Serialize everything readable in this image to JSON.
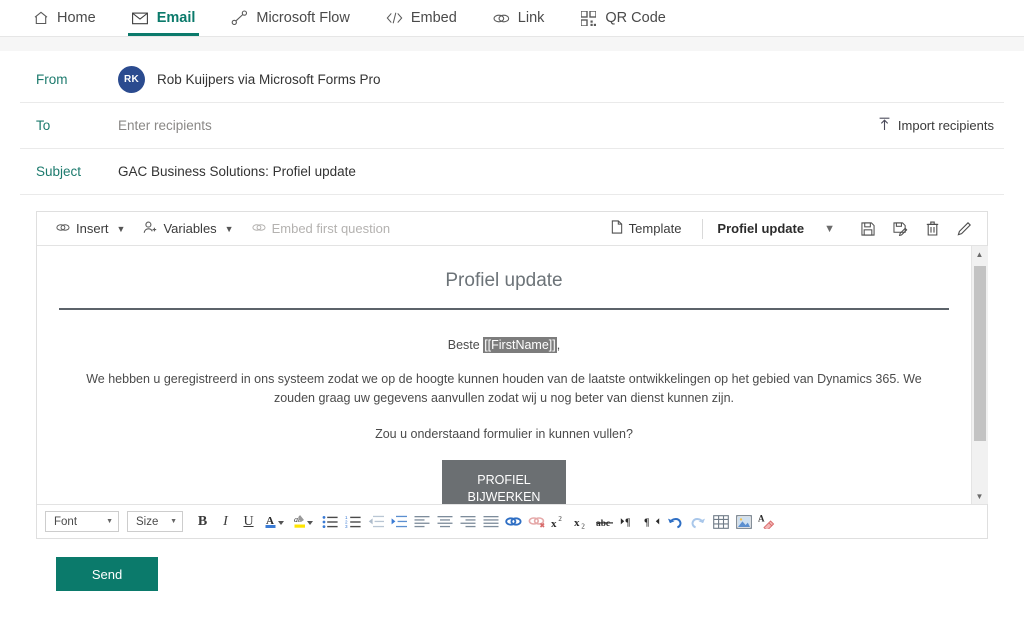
{
  "nav": {
    "tabs": [
      {
        "label": "Home",
        "icon": "home-icon",
        "active": false
      },
      {
        "label": "Email",
        "icon": "envelope-icon",
        "active": true
      },
      {
        "label": "Microsoft Flow",
        "icon": "flow-icon",
        "active": false
      },
      {
        "label": "Embed",
        "icon": "code-icon",
        "active": false
      },
      {
        "label": "Link",
        "icon": "link-icon",
        "active": false
      },
      {
        "label": "QR Code",
        "icon": "qr-code-icon",
        "active": false
      }
    ]
  },
  "compose": {
    "from": {
      "label": "From",
      "avatar_initials": "RK",
      "avatar_color": "#2b4b8f",
      "sender": "Rob Kuijpers via Microsoft Forms Pro"
    },
    "to": {
      "label": "To",
      "placeholder": "Enter recipients",
      "value": "",
      "import_label": "Import recipients"
    },
    "subject": {
      "label": "Subject",
      "value": "GAC Business Solutions: Profiel update"
    }
  },
  "editor_toolbar": {
    "insert_label": "Insert",
    "variables_label": "Variables",
    "embed_first_question_label": "Embed first question",
    "template_label": "Template",
    "template_name": "Profiel update",
    "actions": [
      {
        "name": "save-template-icon",
        "title": "Save"
      },
      {
        "name": "save-as-template-icon",
        "title": "Save as"
      },
      {
        "name": "delete-template-icon",
        "title": "Delete"
      },
      {
        "name": "edit-template-icon",
        "title": "Edit"
      }
    ]
  },
  "email_body": {
    "title": "Profiel update",
    "greeting_prefix": "Beste ",
    "greeting_token": "[[FirstName]]",
    "greeting_suffix": ",",
    "paragraph_1": "We hebben u geregistreerd in ons systeem zodat we op de hoogte kunnen houden van de laatste ontwikkelingen op het gebied van Dynamics 365. We zouden graag uw gegevens aanvullen zodat wij u nog beter van dienst kunnen zijn.",
    "paragraph_2": "Zou u onderstaand formulier in kunnen vullen?",
    "cta_line_1": "PROFIEL",
    "cta_line_2": "BIJWERKEN",
    "cta_color": "#6b6f72"
  },
  "format_toolbar": {
    "font_label": "Font",
    "size_label": "Size",
    "buttons": [
      {
        "name": "bold-icon",
        "glyph": "B"
      },
      {
        "name": "italic-icon",
        "glyph": "I"
      },
      {
        "name": "underline-icon",
        "glyph": "U"
      },
      {
        "name": "text-color-icon",
        "glyph": "A"
      },
      {
        "name": "highlight-color-icon",
        "glyph": "abc"
      },
      {
        "name": "bulleted-list-icon",
        "glyph": ""
      },
      {
        "name": "numbered-list-icon",
        "glyph": ""
      },
      {
        "name": "decrease-indent-icon",
        "glyph": ""
      },
      {
        "name": "increase-indent-icon",
        "glyph": ""
      },
      {
        "name": "align-left-icon",
        "glyph": ""
      },
      {
        "name": "align-center-icon",
        "glyph": ""
      },
      {
        "name": "align-right-icon",
        "glyph": ""
      },
      {
        "name": "align-justify-icon",
        "glyph": ""
      },
      {
        "name": "insert-link-icon",
        "glyph": ""
      },
      {
        "name": "remove-link-icon",
        "glyph": ""
      },
      {
        "name": "superscript-icon",
        "glyph": "x"
      },
      {
        "name": "subscript-icon",
        "glyph": "x"
      },
      {
        "name": "strikethrough-icon",
        "glyph": "abc"
      },
      {
        "name": "text-direction-ltr-icon",
        "glyph": ""
      },
      {
        "name": "text-direction-rtl-icon",
        "glyph": ""
      },
      {
        "name": "undo-icon",
        "glyph": ""
      },
      {
        "name": "redo-icon",
        "glyph": ""
      },
      {
        "name": "insert-table-icon",
        "glyph": ""
      },
      {
        "name": "insert-image-icon",
        "glyph": ""
      },
      {
        "name": "remove-format-icon",
        "glyph": ""
      }
    ]
  },
  "footer": {
    "send_label": "Send",
    "send_color": "#0b7a6b"
  }
}
